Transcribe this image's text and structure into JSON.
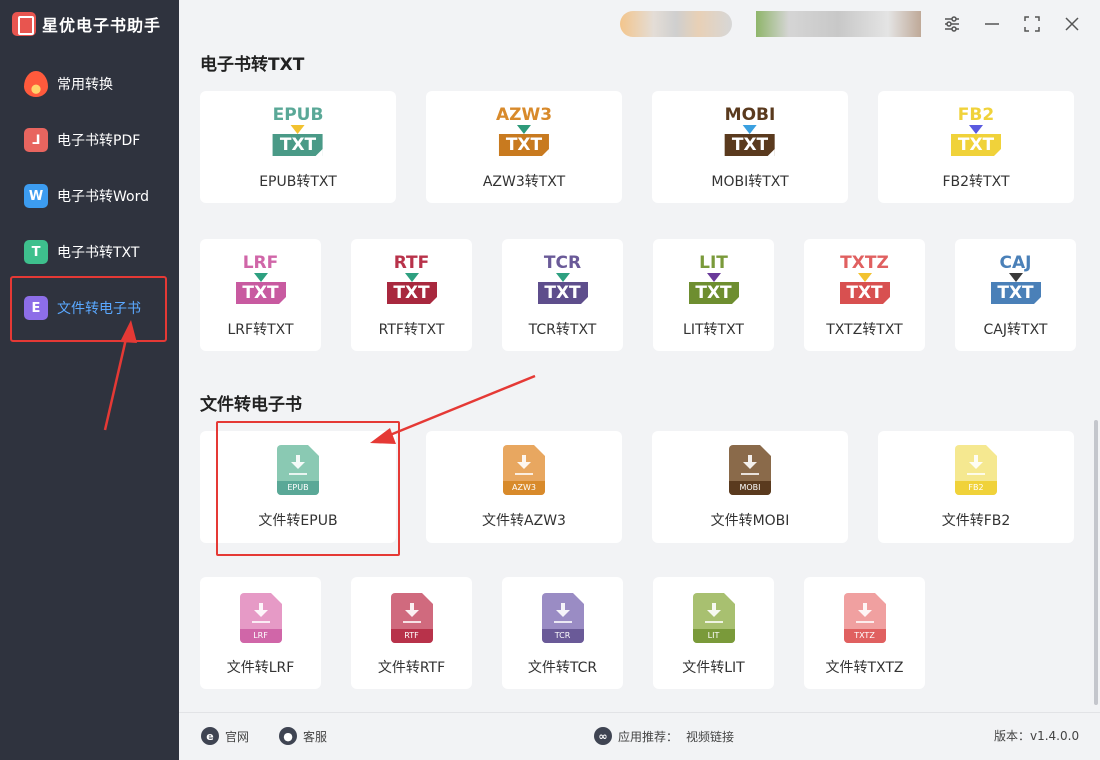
{
  "app": {
    "title": "星优电子书助手"
  },
  "sidebar": {
    "items": [
      {
        "label": "常用转换",
        "icon": "flame-icon"
      },
      {
        "label": "电子书转PDF",
        "icon": "pdf-icon",
        "glyph": "⅃",
        "color": "#e8655f"
      },
      {
        "label": "电子书转Word",
        "icon": "word-icon",
        "glyph": "W",
        "color": "#3c9cf0"
      },
      {
        "label": "电子书转TXT",
        "icon": "txt-icon",
        "glyph": "T",
        "color": "#3ec08d"
      },
      {
        "label": "文件转电子书",
        "icon": "ebook-icon",
        "glyph": "E",
        "color": "#8d6ee8"
      }
    ]
  },
  "sections": {
    "to_txt": {
      "title": "电子书转TXT",
      "row1": [
        {
          "label": "EPUB转TXT",
          "fmt": "EPUB",
          "color": "#5aa897",
          "arrow": "#f2c230",
          "box": "#4a9a87"
        },
        {
          "label": "AZW3转TXT",
          "fmt": "AZW3",
          "color": "#d88a2b",
          "arrow": "#2e9a7a",
          "box": "#c87a1f"
        },
        {
          "label": "MOBI转TXT",
          "fmt": "MOBI",
          "color": "#5a3a1e",
          "arrow": "#3aa0e0",
          "box": "#5a3a1e"
        },
        {
          "label": "FB2转TXT",
          "fmt": "FB2",
          "color": "#f0d23a",
          "arrow": "#5a5ae0",
          "box": "#f0d23a"
        }
      ],
      "row2": [
        {
          "label": "LRF转TXT",
          "fmt": "LRF",
          "color": "#d066a8",
          "arrow": "#2ea080",
          "box": "#c85aa0"
        },
        {
          "label": "RTF转TXT",
          "fmt": "RTF",
          "color": "#b8324a",
          "arrow": "#2ea080",
          "box": "#a8283e"
        },
        {
          "label": "TCR转TXT",
          "fmt": "TCR",
          "color": "#6a5a98",
          "arrow": "#2ea080",
          "box": "#5e4e8c"
        },
        {
          "label": "LIT转TXT",
          "fmt": "LIT",
          "color": "#7a9a3a",
          "arrow": "#6a3a9a",
          "box": "#6e8e30"
        },
        {
          "label": "TXTZ转TXT",
          "fmt": "TXTZ",
          "color": "#e06060",
          "arrow": "#f2c230",
          "box": "#d85050"
        },
        {
          "label": "CAJ转TXT",
          "fmt": "CAJ",
          "color": "#4a80b8",
          "arrow": "#3a3a3a",
          "box": "#4a80b8"
        }
      ]
    },
    "to_ebook": {
      "title": "文件转电子书",
      "row1": [
        {
          "label": "文件转EPUB",
          "fmt": "EPUB",
          "color": "#8ac9b3",
          "band": "#5aa897"
        },
        {
          "label": "文件转AZW3",
          "fmt": "AZW3",
          "color": "#e8a760",
          "band": "#d88a2b"
        },
        {
          "label": "文件转MOBI",
          "fmt": "MOBI",
          "color": "#8a6a4a",
          "band": "#5a3a1e"
        },
        {
          "label": "文件转FB2",
          "fmt": "FB2",
          "color": "#f5e890",
          "band": "#f0d23a"
        }
      ],
      "row2": [
        {
          "label": "文件转LRF",
          "fmt": "LRF",
          "color": "#e69ac6",
          "band": "#d066a8"
        },
        {
          "label": "文件转RTF",
          "fmt": "RTF",
          "color": "#d06a7e",
          "band": "#b8324a"
        },
        {
          "label": "文件转TCR",
          "fmt": "TCR",
          "color": "#9a8cc4",
          "band": "#6a5a98"
        },
        {
          "label": "文件转LIT",
          "fmt": "LIT",
          "color": "#a8c070",
          "band": "#7a9a3a"
        },
        {
          "label": "文件转TXTZ",
          "fmt": "TXTZ",
          "color": "#f0a0a0",
          "band": "#e06060"
        }
      ]
    }
  },
  "footer": {
    "website": "官网",
    "service": "客服",
    "recommend_label": "应用推荐：",
    "recommend_value": "视频链接",
    "version": "版本：v1.4.0.0"
  }
}
